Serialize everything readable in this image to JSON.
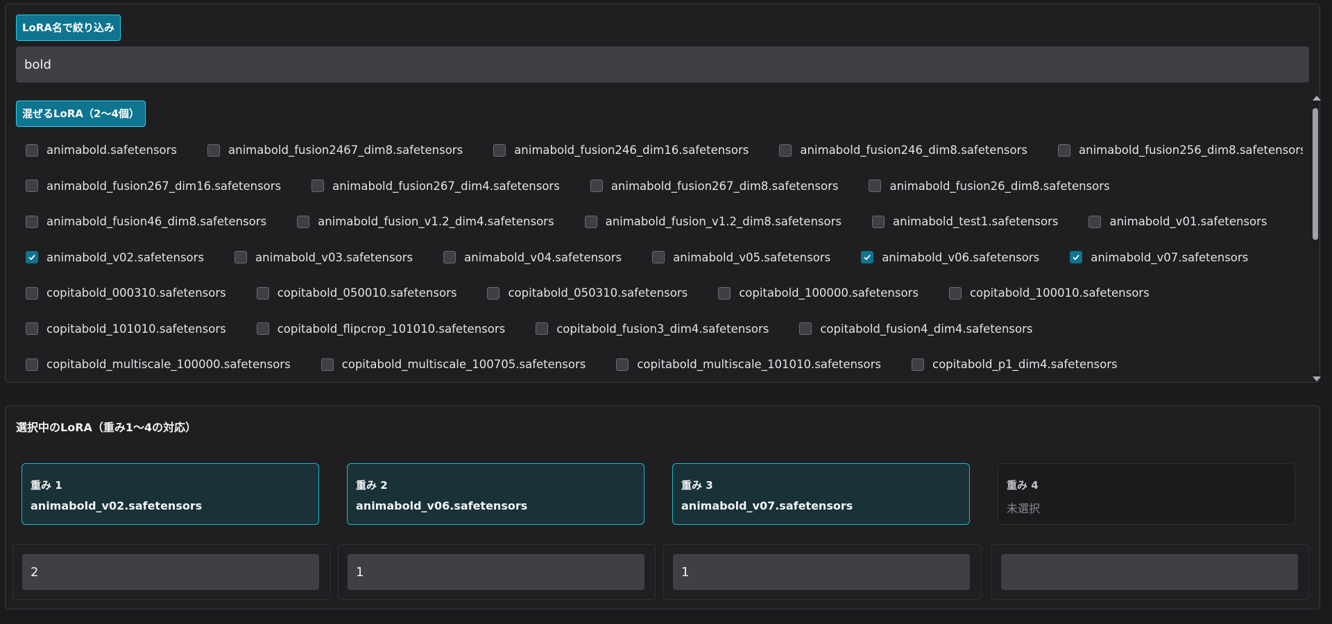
{
  "filter": {
    "label": "LoRA名で絞り込み",
    "value": "bold"
  },
  "mix": {
    "label": "混ぜるLoRA（2〜4個）",
    "rows": [
      [
        {
          "name": "animabold.safetensors",
          "checked": false
        },
        {
          "name": "animabold_fusion2467_dim8.safetensors",
          "checked": false
        },
        {
          "name": "animabold_fusion246_dim16.safetensors",
          "checked": false
        },
        {
          "name": "animabold_fusion246_dim8.safetensors",
          "checked": false
        },
        {
          "name": "animabold_fusion256_dim8.safetensors",
          "checked": false
        }
      ],
      [
        {
          "name": "animabold_fusion267_dim16.safetensors",
          "checked": false
        },
        {
          "name": "animabold_fusion267_dim4.safetensors",
          "checked": false
        },
        {
          "name": "animabold_fusion267_dim8.safetensors",
          "checked": false
        },
        {
          "name": "animabold_fusion26_dim8.safetensors",
          "checked": false
        }
      ],
      [
        {
          "name": "animabold_fusion46_dim8.safetensors",
          "checked": false
        },
        {
          "name": "animabold_fusion_v1.2_dim4.safetensors",
          "checked": false
        },
        {
          "name": "animabold_fusion_v1.2_dim8.safetensors",
          "checked": false
        },
        {
          "name": "animabold_test1.safetensors",
          "checked": false
        },
        {
          "name": "animabold_v01.safetensors",
          "checked": false
        }
      ],
      [
        {
          "name": "animabold_v02.safetensors",
          "checked": true
        },
        {
          "name": "animabold_v03.safetensors",
          "checked": false
        },
        {
          "name": "animabold_v04.safetensors",
          "checked": false
        },
        {
          "name": "animabold_v05.safetensors",
          "checked": false
        },
        {
          "name": "animabold_v06.safetensors",
          "checked": true
        },
        {
          "name": "animabold_v07.safetensors",
          "checked": true
        }
      ],
      [
        {
          "name": "copitabold_000310.safetensors",
          "checked": false
        },
        {
          "name": "copitabold_050010.safetensors",
          "checked": false
        },
        {
          "name": "copitabold_050310.safetensors",
          "checked": false
        },
        {
          "name": "copitabold_100000.safetensors",
          "checked": false
        },
        {
          "name": "copitabold_100010.safetensors",
          "checked": false
        }
      ],
      [
        {
          "name": "copitabold_101010.safetensors",
          "checked": false
        },
        {
          "name": "copitabold_flipcrop_101010.safetensors",
          "checked": false
        },
        {
          "name": "copitabold_fusion3_dim4.safetensors",
          "checked": false
        },
        {
          "name": "copitabold_fusion4_dim4.safetensors",
          "checked": false
        }
      ],
      [
        {
          "name": "copitabold_multiscale_100000.safetensors",
          "checked": false
        },
        {
          "name": "copitabold_multiscale_100705.safetensors",
          "checked": false
        },
        {
          "name": "copitabold_multiscale_101010.safetensors",
          "checked": false
        },
        {
          "name": "copitabold_p1_dim4.safetensors",
          "checked": false
        }
      ]
    ]
  },
  "selected": {
    "title": "選択中のLoRA（重み1〜4の対応）",
    "slots": [
      {
        "label": "重み 1",
        "name": "animabold_v02.safetensors",
        "weight": "2"
      },
      {
        "label": "重み 2",
        "name": "animabold_v06.safetensors",
        "weight": "1"
      },
      {
        "label": "重み 3",
        "name": "animabold_v07.safetensors",
        "weight": "1"
      },
      {
        "label": "重み 4",
        "name": "未選択",
        "weight": ""
      }
    ]
  },
  "colors": {
    "accent": "#0e7490",
    "accent_border": "#22d3ee",
    "background": "#1b1b1e"
  },
  "icons": {
    "checkbox": "checkbox-icon",
    "check": "checkmark-icon",
    "scroll_up": "scroll-up-arrow-icon",
    "scroll_down": "scroll-down-arrow-icon"
  }
}
